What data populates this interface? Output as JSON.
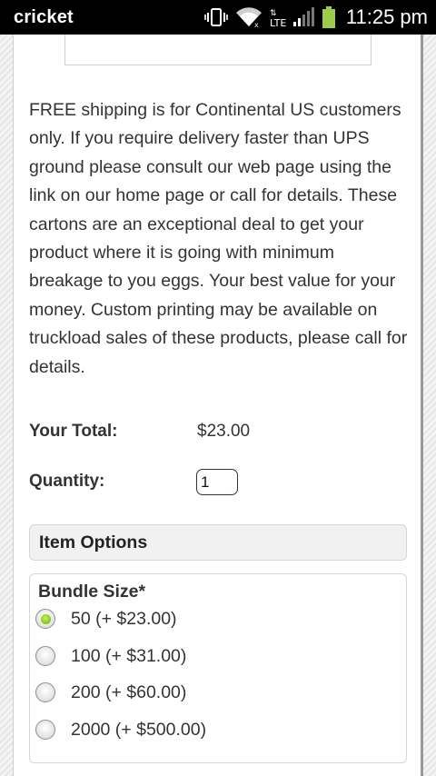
{
  "statusbar": {
    "carrier": "cricket",
    "network": "LTE",
    "time": "11:25 pm",
    "icons": [
      "vibrate-icon",
      "wifi-icon",
      "lte-signal-icon",
      "battery-icon"
    ],
    "battery_color": "#8bc34a"
  },
  "product": {
    "description": "FREE shipping is for Continental US customers only. If you require delivery faster than UPS ground please consult our web page using the link on our home page or call for details. These cartons are an exceptional deal to get your product where it is going with minimum breakage to you eggs. Your best value for your money. Custom printing may be available on truckload sales of these products, please call for details.",
    "total_label": "Your Total:",
    "total_value": "$23.00",
    "quantity_label": "Quantity:",
    "quantity_value": "1"
  },
  "item_options": {
    "header": "Item Options",
    "bundle_label": "Bundle Size*",
    "options": [
      {
        "label": "50 (+ $23.00)",
        "selected": true
      },
      {
        "label": "100 (+ $31.00)",
        "selected": false
      },
      {
        "label": "200 (+ $60.00)",
        "selected": false
      },
      {
        "label": "2000 (+ $500.00)",
        "selected": false
      }
    ],
    "selected_color": "#8ccc1a"
  }
}
